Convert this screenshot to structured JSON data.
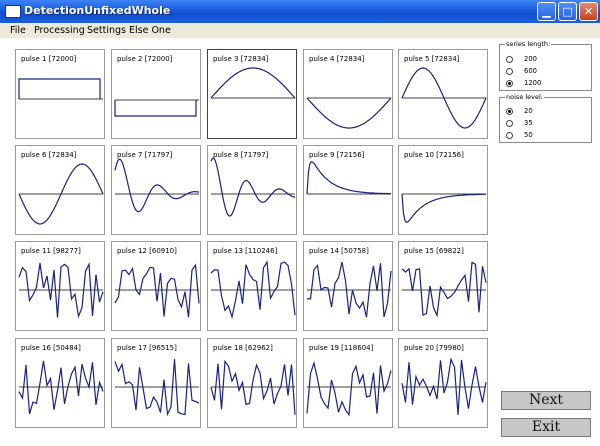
{
  "window": {
    "title": "DetectionUnfixedWhole"
  },
  "menu": [
    "File",
    "Processing",
    "Settings",
    "Else One"
  ],
  "colors": {
    "signal": "#1a237e",
    "axis": "#000000",
    "titlebar": "#1e5fe0"
  },
  "pulses": [
    {
      "label": "pulse 1 [72000]"
    },
    {
      "label": "pulse 2 [72000]"
    },
    {
      "label": "pulse 3 [72834]"
    },
    {
      "label": "pulse 4 [72834]"
    },
    {
      "label": "pulse 5 [72834]"
    },
    {
      "label": "pulse 6 [72834]"
    },
    {
      "label": "pulse 7 [71797]"
    },
    {
      "label": "pulse 8 [71797]"
    },
    {
      "label": "pulse 9 [72156]"
    },
    {
      "label": "pulse 10 [72156]"
    },
    {
      "label": "pulse 11 [98277]"
    },
    {
      "label": "pulse 12 [60910]"
    },
    {
      "label": "pulse 13 [110246]"
    },
    {
      "label": "pulse 14 [50758]"
    },
    {
      "label": "pulse 15 [69822]"
    },
    {
      "label": "pulse 16 [50484]"
    },
    {
      "label": "pulse 17 [96515]"
    },
    {
      "label": "pulse 18 [62962]"
    },
    {
      "label": "pulse 19 [118604]"
    },
    {
      "label": "pulse 20 [79980]"
    }
  ],
  "series_length": {
    "label": "series length:",
    "options": [
      "200",
      "600",
      "1200"
    ],
    "selected": "1200"
  },
  "noise_level": {
    "label": "noise level:",
    "options": [
      "20",
      "35",
      "50"
    ],
    "selected": "20"
  },
  "buttons": {
    "next": "Next",
    "exit": "Exit"
  },
  "selected_panel": "pulse 3 [72834]"
}
